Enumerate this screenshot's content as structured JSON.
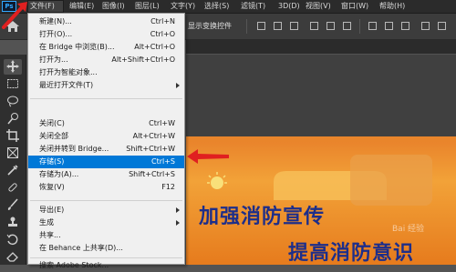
{
  "app": {
    "logo": "Ps"
  },
  "menubar": {
    "items": [
      {
        "label": "文件(F)",
        "active": true
      },
      {
        "label": "编辑(E)"
      },
      {
        "label": "图像(I)"
      },
      {
        "label": "图层(L)"
      },
      {
        "label": "文字(Y)"
      },
      {
        "label": "选择(S)"
      },
      {
        "label": "滤镜(T)"
      },
      {
        "label": "3D(D)"
      },
      {
        "label": "视图(V)"
      },
      {
        "label": "窗口(W)"
      },
      {
        "label": "帮助(H)"
      }
    ]
  },
  "options_bar": {
    "transform_label": "显示变换控件"
  },
  "file_menu": {
    "items": [
      {
        "label": "新建(N)...",
        "shortcut": "Ctrl+N"
      },
      {
        "label": "打开(O)...",
        "shortcut": "Ctrl+O"
      },
      {
        "label": "在 Bridge 中浏览(B)...",
        "shortcut": "Alt+Ctrl+O"
      },
      {
        "label": "打开为...",
        "shortcut": "Alt+Shift+Ctrl+O"
      },
      {
        "label": "打开为智能对象..."
      },
      {
        "label": "最近打开文件(T)",
        "submenu": true
      },
      {
        "label": "关闭(C)",
        "shortcut": "Ctrl+W"
      },
      {
        "label": "关闭全部",
        "shortcut": "Alt+Ctrl+W"
      },
      {
        "label": "关闭并转到 Bridge...",
        "shortcut": "Shift+Ctrl+W"
      },
      {
        "label": "存储(S)",
        "shortcut": "Ctrl+S",
        "highlighted": true
      },
      {
        "label": "存储为(A)...",
        "shortcut": "Shift+Ctrl+S"
      },
      {
        "label": "恢复(V)",
        "shortcut": "F12"
      },
      {
        "label": "导出(E)",
        "submenu": true
      },
      {
        "label": "生成",
        "submenu": true
      },
      {
        "label": "共享..."
      },
      {
        "label": "在 Behance 上共享(D)..."
      },
      {
        "label": "搜索 Adobe Stock..."
      }
    ]
  },
  "document": {
    "line1": "加强消防宣传",
    "line2": "提高消防意识"
  },
  "watermark": "Bai 经验",
  "colors": {
    "highlight": "#0078d7",
    "arrow": "#e02020",
    "ps_blue": "#31a8ff",
    "poster_text": "#1d2e8a"
  },
  "tools": [
    "move-tool-icon",
    "marquee-tool-icon",
    "lasso-tool-icon",
    "quick-select-tool-icon",
    "crop-tool-icon",
    "frame-tool-icon",
    "eyedropper-tool-icon",
    "healing-brush-tool-icon",
    "brush-tool-icon",
    "clone-stamp-tool-icon",
    "history-brush-tool-icon",
    "eraser-tool-icon"
  ]
}
